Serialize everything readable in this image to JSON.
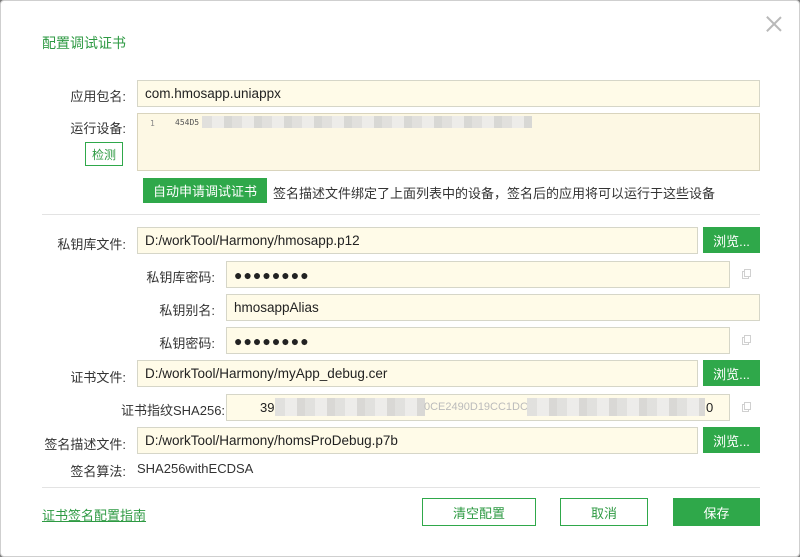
{
  "dialog": {
    "title": "配置调试证书"
  },
  "bundle": {
    "label": "应用包名:",
    "value": "com.hmosapp.uniappx"
  },
  "devices": {
    "label": "运行设备:",
    "detect_label": "检测",
    "line_number": "1",
    "line_prefix": "454D5"
  },
  "auto_apply": {
    "button_label": "自动申请调试证书",
    "note": "签名描述文件绑定了上面列表中的设备，签名后的应用将可以运行于这些设备"
  },
  "keystore": {
    "label": "私钥库文件:",
    "value": "D:/workTool/Harmony/hmosapp.p12",
    "browse_label": "浏览..."
  },
  "keystore_password": {
    "label": "私钥库密码:",
    "value": "●●●●●●●●"
  },
  "key_alias": {
    "label": "私钥别名:",
    "value": "hmosappAlias"
  },
  "key_password": {
    "label": "私钥密码:",
    "value": "●●●●●●●●"
  },
  "cert": {
    "label": "证书文件:",
    "value": "D:/workTool/Harmony/myApp_debug.cer",
    "browse_label": "浏览..."
  },
  "fingerprint": {
    "label": "证书指纹SHA256:",
    "value_start": "39",
    "value_mid": "0CE2490D19CC1DC",
    "value_end": "0"
  },
  "profile": {
    "label": "签名描述文件:",
    "value": "D:/workTool/Harmony/homsProDebug.p7b",
    "browse_label": "浏览..."
  },
  "algorithm": {
    "label": "签名算法:",
    "value": "SHA256withECDSA"
  },
  "footer": {
    "guide_link": "证书签名配置指南",
    "clear_label": "清空配置",
    "cancel_label": "取消",
    "save_label": "保存"
  },
  "colors": {
    "accent": "#2fa84a",
    "field_bg": "#fffbe8"
  }
}
